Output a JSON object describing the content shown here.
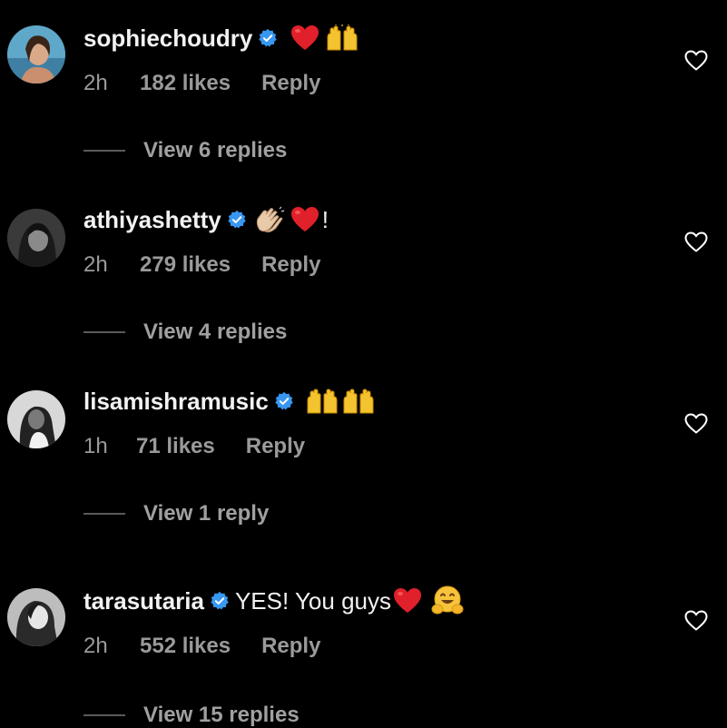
{
  "comments": [
    {
      "username": "sophiechoudry",
      "text": "",
      "time": "2h",
      "likes": "182 likes",
      "reply": "Reply",
      "view_replies": "View 6 replies"
    },
    {
      "username": "athiyashetty",
      "text": "!",
      "time": "2h",
      "likes": "279 likes",
      "reply": "Reply",
      "view_replies": "View 4 replies"
    },
    {
      "username": "lisamishramusic",
      "text": "",
      "time": "1h",
      "likes": "71 likes",
      "reply": "Reply",
      "view_replies": "View 1 reply"
    },
    {
      "username": "tarasutaria",
      "text": "YES! You guys",
      "time": "2h",
      "likes": "552 likes",
      "reply": "Reply",
      "view_replies": "View 15 replies"
    }
  ],
  "colors": {
    "background": "#000000",
    "verified": "#3897f0",
    "meta": "#9a9a9a"
  }
}
